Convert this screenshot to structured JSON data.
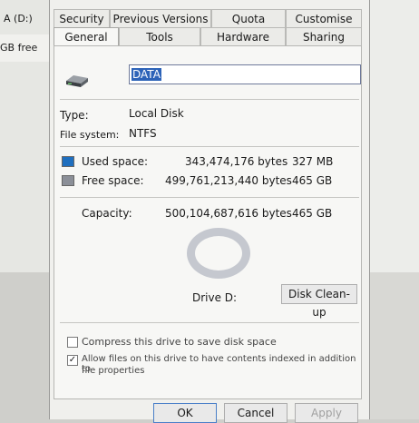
{
  "background_window": {
    "drive_label": "A (D:)",
    "free_label": "GB free"
  },
  "tabs": {
    "back": [
      "Security",
      "Previous Versions",
      "Quota",
      "Customise"
    ],
    "front": [
      "General",
      "Tools",
      "Hardware",
      "Sharing"
    ]
  },
  "general": {
    "drive_name": "DATA",
    "type_label": "Type:",
    "type_value": "Local Disk",
    "fs_label": "File system:",
    "fs_value": "NTFS",
    "used_label": "Used space:",
    "used_bytes": "343,474,176 bytes",
    "used_size": "327 MB",
    "free_label": "Free space:",
    "free_bytes": "499,761,213,440 bytes",
    "free_size": "465 GB",
    "capacity_label": "Capacity:",
    "capacity_bytes": "500,104,687,616 bytes",
    "capacity_size": "465 GB",
    "drive_caption": "Drive D:",
    "cleanup_button": "Disk Clean-up",
    "compress_label": "Compress this drive to save disk space",
    "compress_checked": false,
    "index_label_1": "Allow files on this drive to have contents indexed in addition to",
    "index_label_2": "file properties",
    "index_checked": true
  },
  "buttons": {
    "ok": "OK",
    "cancel": "Cancel",
    "apply": "Apply"
  },
  "colors": {
    "used": "#1f6fbf",
    "free": "#8b8f98",
    "selection": "#2d63b8"
  },
  "icons": {
    "drive": "hard-drive-icon",
    "check": "checkmark-icon"
  }
}
